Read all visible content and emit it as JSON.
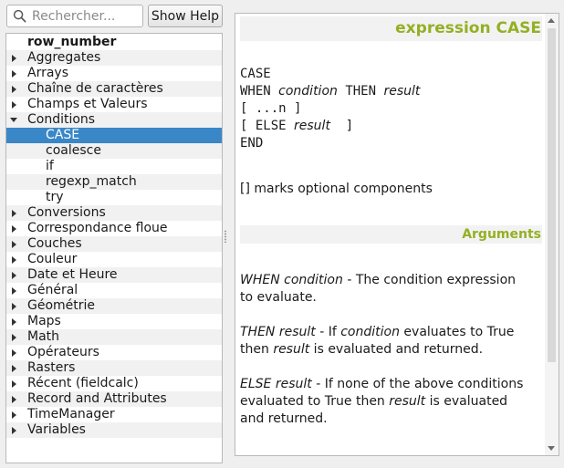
{
  "search": {
    "placeholder": "Rechercher...",
    "value": ""
  },
  "show_help_label": "Show Help",
  "tree": [
    {
      "label": "row_number",
      "bold": true,
      "indent": 0,
      "arrow": "none"
    },
    {
      "label": "Aggregates",
      "indent": 0,
      "arrow": "right"
    },
    {
      "label": "Arrays",
      "indent": 0,
      "arrow": "right"
    },
    {
      "label": "Chaîne de caractères",
      "indent": 0,
      "arrow": "right"
    },
    {
      "label": "Champs et Valeurs",
      "indent": 0,
      "arrow": "right"
    },
    {
      "label": "Conditions",
      "indent": 0,
      "arrow": "down"
    },
    {
      "label": "CASE",
      "indent": 1,
      "arrow": "none",
      "selected": true
    },
    {
      "label": "coalesce",
      "indent": 1,
      "arrow": "none"
    },
    {
      "label": "if",
      "indent": 1,
      "arrow": "none"
    },
    {
      "label": "regexp_match",
      "indent": 1,
      "arrow": "none"
    },
    {
      "label": "try",
      "indent": 1,
      "arrow": "none"
    },
    {
      "label": "Conversions",
      "indent": 0,
      "arrow": "right"
    },
    {
      "label": "Correspondance floue",
      "indent": 0,
      "arrow": "right"
    },
    {
      "label": "Couches",
      "indent": 0,
      "arrow": "right"
    },
    {
      "label": "Couleur",
      "indent": 0,
      "arrow": "right"
    },
    {
      "label": "Date et Heure",
      "indent": 0,
      "arrow": "right"
    },
    {
      "label": "Général",
      "indent": 0,
      "arrow": "right"
    },
    {
      "label": "Géométrie",
      "indent": 0,
      "arrow": "right"
    },
    {
      "label": "Maps",
      "indent": 0,
      "arrow": "right"
    },
    {
      "label": "Math",
      "indent": 0,
      "arrow": "right"
    },
    {
      "label": "Opérateurs",
      "indent": 0,
      "arrow": "right"
    },
    {
      "label": "Rasters",
      "indent": 0,
      "arrow": "right"
    },
    {
      "label": "Récent (fieldcalc)",
      "indent": 0,
      "arrow": "right"
    },
    {
      "label": "Record and Attributes",
      "indent": 0,
      "arrow": "right"
    },
    {
      "label": "TimeManager",
      "indent": 0,
      "arrow": "right"
    },
    {
      "label": "Variables",
      "indent": 0,
      "arrow": "right"
    }
  ],
  "help": {
    "title": "expression CASE",
    "code": {
      "l1": "CASE",
      "l2_kw1": "WHEN",
      "l2_arg1": "condition",
      "l2_kw2": "THEN",
      "l2_arg2": "result",
      "l3": "[ ...n ]",
      "l4_a": "[ ELSE",
      "l4_arg": "result",
      "l4_b": "]",
      "l5": "END"
    },
    "note": "[] marks optional components",
    "arguments_title": "Arguments",
    "args": [
      {
        "name": "WHEN condition",
        "text": " - The condition expression to evaluate."
      },
      {
        "name": "THEN result",
        "text_parts": [
          " - If ",
          "condition",
          " evaluates to True then ",
          "result",
          " is evaluated and returned."
        ]
      },
      {
        "name": "ELSE result",
        "text_parts": [
          " - If none of the above conditions evaluated to True then ",
          "result",
          " is evaluated and returned."
        ]
      }
    ]
  },
  "colors": {
    "accent_green": "#93b023",
    "selection": "#3a87c8"
  }
}
